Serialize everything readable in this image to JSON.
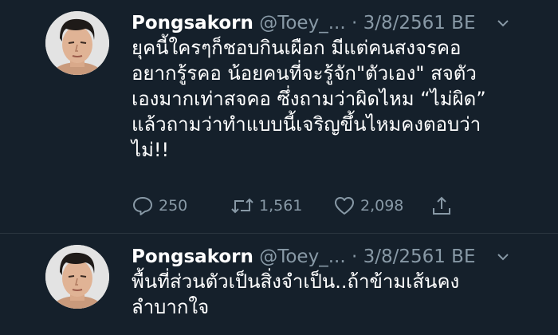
{
  "colors": {
    "background": "#15202b",
    "name": "#ffffff",
    "secondary_text": "#8899a6",
    "divider": "#2b3640"
  },
  "tweets": [
    {
      "author": {
        "name": "Pongsakorn",
        "handle": "@Toey_...",
        "avatar_icon": "user-avatar-icon"
      },
      "separator": "·",
      "date": "3/8/2561 BE",
      "text_lines": [
        "ยุคนี้ใครๆก็ชอบกินเผือก มีแต่คนสงจรคอ",
        "อยากรู้รคอ น้อยคนที่จะรู้จัก\"ตัวเอง\" สจตัว",
        "เองมากเท่าสจคอ ซึ่งถามว่าผิดไหม “ไม่ผิด”",
        "แล้วถามว่าทำแบบนี้เจริญขึ้นไหมคงตอบว่า",
        "ไม่!!"
      ],
      "actions": {
        "reply_count": "250",
        "retweet_count": "1,561",
        "like_count": "2,098"
      }
    },
    {
      "author": {
        "name": "Pongsakorn",
        "handle": "@Toey_...",
        "avatar_icon": "user-avatar-icon"
      },
      "separator": "·",
      "date": "3/8/2561 BE",
      "text_lines": [
        "พื้นที่ส่วนตัวเป็นสิ่งจำเป็น..ถ้าข้ามเส้นคง",
        "ลำบากใจ"
      ]
    }
  ]
}
